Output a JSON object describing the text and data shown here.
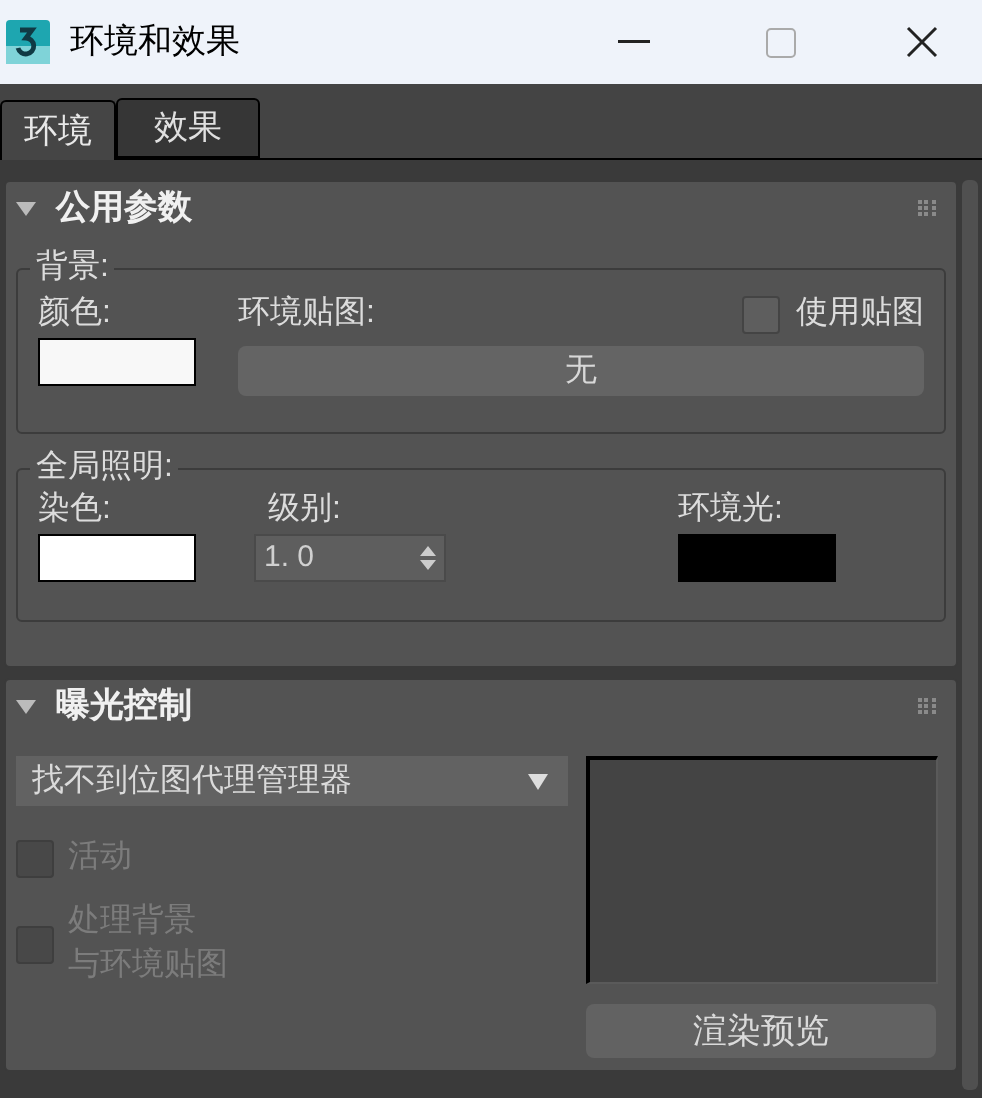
{
  "window": {
    "title": "环境和效果"
  },
  "tabs": [
    {
      "label": "环境",
      "selected": true
    },
    {
      "label": "效果",
      "selected": false
    }
  ],
  "common_parameters": {
    "title": "公用参数",
    "expanded": true,
    "background": {
      "label": "背景:",
      "color_label": "颜色:",
      "color": "#f8f8f8",
      "map_label": "环境贴图:",
      "use_map": {
        "label": "使用贴图",
        "checked": false
      },
      "map_button": "无"
    },
    "global_lighting": {
      "label": "全局照明:",
      "tint": {
        "label": "染色:",
        "color": "#ffffff"
      },
      "level_label": "级别:",
      "level_value": "1. 0",
      "ambient": {
        "label": "环境光:",
        "color": "#000000"
      }
    }
  },
  "exposure_control": {
    "title": "曝光控制",
    "expanded": true,
    "dropdown": "找不到位图代理管理器",
    "checkboxes": [
      {
        "label": "活动",
        "checked": false,
        "disabled": true
      },
      {
        "label_lines": [
          "处理背景",
          "与环境贴图"
        ],
        "checked": false,
        "disabled": true
      }
    ],
    "render_preview_button": "渲染预览"
  }
}
